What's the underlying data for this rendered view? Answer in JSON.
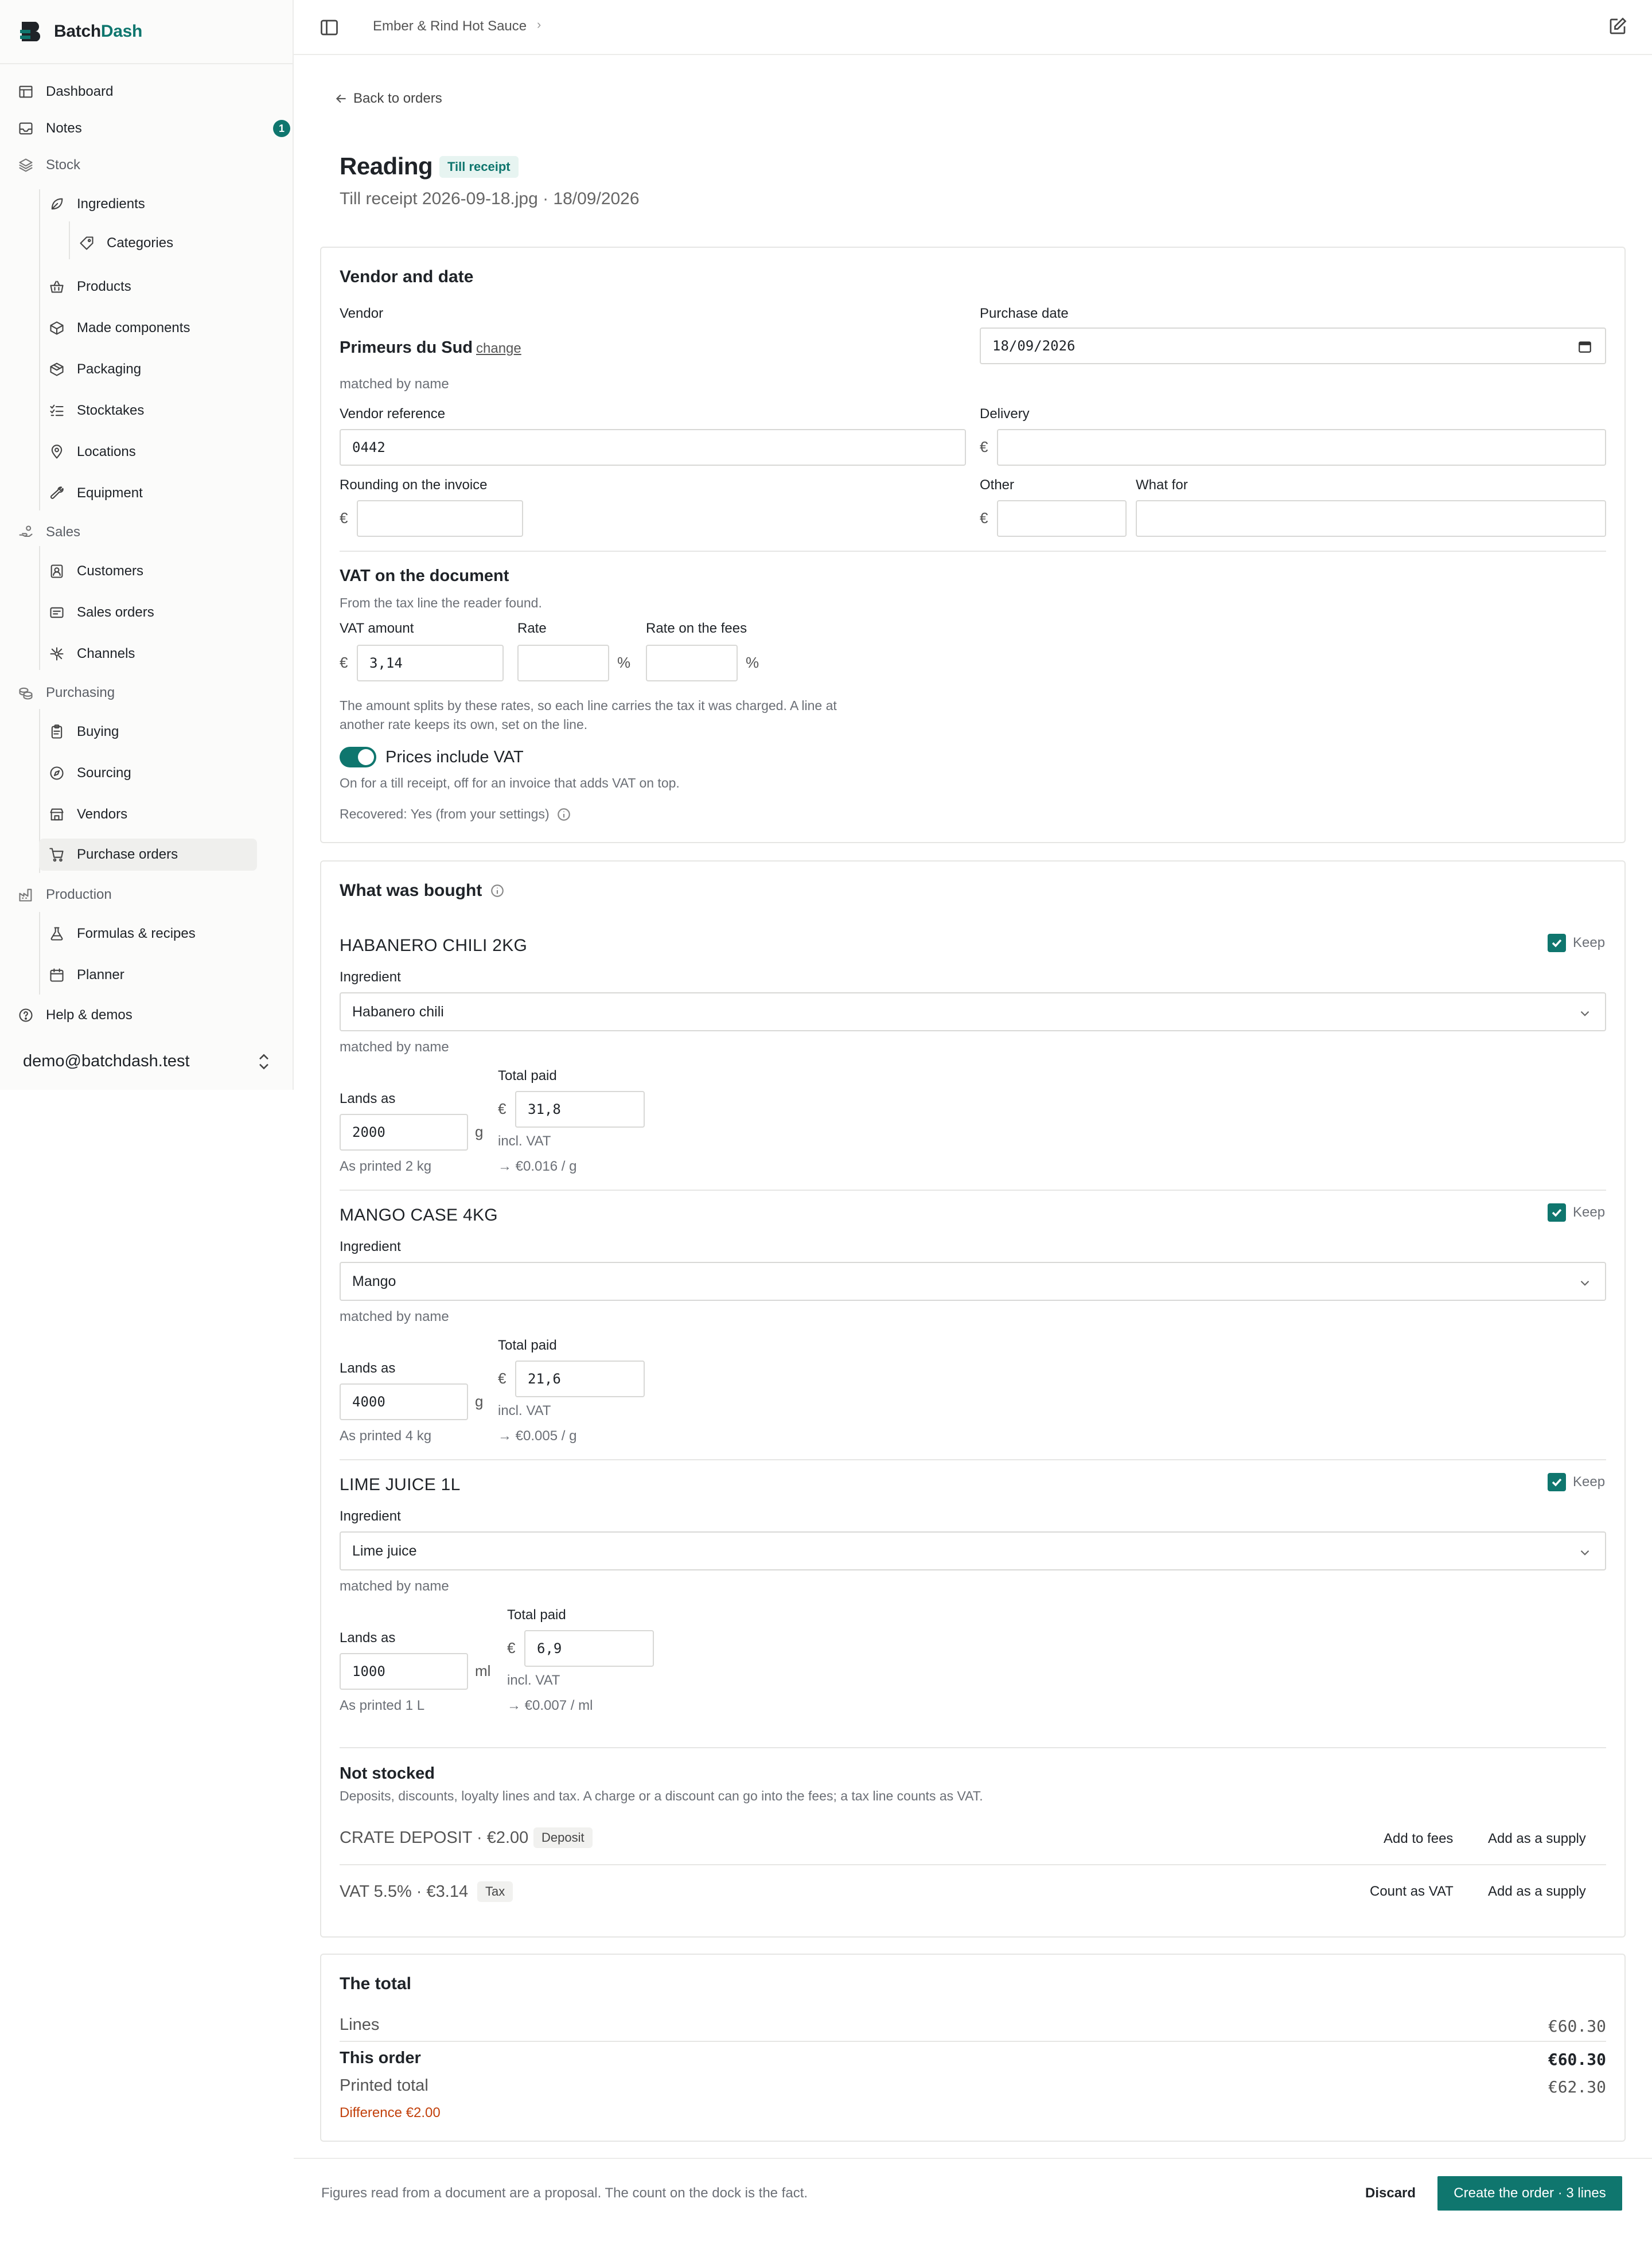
{
  "app": {
    "name_prefix": "Batch",
    "name_suffix": "Dash"
  },
  "colors": {
    "accent": "#0f766e",
    "warning": "#c2410c"
  },
  "sidebar": {
    "items": [
      {
        "label": "Dashboard",
        "icon": "table-icon"
      },
      {
        "label": "Notes",
        "icon": "inbox-icon",
        "badge": "1"
      },
      {
        "label": "Stock",
        "icon": "layers-icon"
      },
      {
        "label": "Ingredients",
        "icon": "leaf-icon"
      },
      {
        "label": "Categories",
        "icon": "tag-icon"
      },
      {
        "label": "Products",
        "icon": "basket-icon"
      },
      {
        "label": "Made components",
        "icon": "box-icon"
      },
      {
        "label": "Packaging",
        "icon": "package-icon"
      },
      {
        "label": "Stocktakes",
        "icon": "list-check-icon"
      },
      {
        "label": "Locations",
        "icon": "map-pin-icon"
      },
      {
        "label": "Equipment",
        "icon": "wrench-icon"
      },
      {
        "label": "Sales",
        "icon": "hand-coins-icon"
      },
      {
        "label": "Customers",
        "icon": "contact-icon"
      },
      {
        "label": "Sales orders",
        "icon": "receipt-icon"
      },
      {
        "label": "Channels",
        "icon": "network-icon"
      },
      {
        "label": "Purchasing",
        "icon": "coins-icon"
      },
      {
        "label": "Buying",
        "icon": "clipboard-icon"
      },
      {
        "label": "Sourcing",
        "icon": "compass-icon"
      },
      {
        "label": "Vendors",
        "icon": "store-icon"
      },
      {
        "label": "Purchase orders",
        "icon": "cart-icon"
      },
      {
        "label": "Production",
        "icon": "factory-icon"
      },
      {
        "label": "Formulas & recipes",
        "icon": "flask-icon"
      },
      {
        "label": "Planner",
        "icon": "calendar-icon"
      },
      {
        "label": "Help & demos",
        "icon": "help-icon"
      }
    ],
    "account": "demo@batchdash.test"
  },
  "header": {
    "breadcrumb": "Ember & Rind Hot Sauce"
  },
  "page": {
    "back_label": "Back to orders",
    "title": "Reading",
    "tag": "Till receipt",
    "subtitle": "Till receipt 2026-09-18.jpg · 18/09/2026"
  },
  "vendor_card": {
    "title": "Vendor and date",
    "vendor_label": "Vendor",
    "vendor_name": "Primeurs du Sud",
    "change_label": "change",
    "match_note": "matched by name",
    "purchase_date_label": "Purchase date",
    "purchase_date": "18/09/2026",
    "vendor_ref_label": "Vendor reference",
    "vendor_ref": "0442",
    "delivery_label": "Delivery",
    "delivery_value": "",
    "rounding_label": "Rounding on the invoice",
    "rounding_value": "",
    "other_label": "Other",
    "other_value": "",
    "what_for_label": "What for",
    "what_for_value": "",
    "currency": "€",
    "vat_title": "VAT on the document",
    "vat_source": "From the tax line the reader found.",
    "vat_amount_label": "VAT amount",
    "vat_amount": "3,14",
    "rate_label": "Rate",
    "rate_value": "",
    "fees_rate_label": "Rate on the fees",
    "fees_rate_value": "",
    "percent": "%",
    "vat_help_1": "The amount splits by these rates, so each line carries the tax it was charged. A line at",
    "vat_help_2": "another rate keeps its own, set on the line.",
    "prices_incl_label": "Prices include VAT",
    "prices_incl_on": true,
    "prices_incl_help": "On for a till receipt, off for an invoice that adds VAT on top.",
    "recovered": "Recovered: Yes (from your settings)"
  },
  "bought_card": {
    "title": "What was bought",
    "keep_label": "Keep",
    "ingredient_label": "Ingredient",
    "match_note": "matched by name",
    "lands_label": "Lands as",
    "total_label": "Total paid",
    "incl_vat": "incl. VAT",
    "lines": [
      {
        "name": "HABANERO CHILI 2KG",
        "ingredient": "Habanero chili",
        "lands": "2000",
        "unit": "g",
        "printed": "As printed 2 kg",
        "total": "31,8",
        "unit_cost": "→ €0.016 / g",
        "keep": true
      },
      {
        "name": "MANGO CASE 4KG",
        "ingredient": "Mango",
        "lands": "4000",
        "unit": "g",
        "printed": "As printed 4 kg",
        "total": "21,6",
        "unit_cost": "→ €0.005 / g",
        "keep": true
      },
      {
        "name": "LIME JUICE 1L",
        "ingredient": "Lime juice",
        "lands": "1000",
        "unit": "ml",
        "printed": "As printed 1 L",
        "total": "6,9",
        "unit_cost": "→ €0.007 / ml",
        "keep": true
      }
    ],
    "not_stocked_title": "Not stocked",
    "not_stocked_help": "Deposits, discounts, loyalty lines and tax. A charge or a discount can go into the fees; a tax line counts as VAT.",
    "extras": [
      {
        "label": "CRATE DEPOSIT · €2.00",
        "pill": "Deposit",
        "action1": "Add to fees",
        "action2": "Add as a supply"
      },
      {
        "label": "VAT 5.5% · €3.14",
        "pill": "Tax",
        "action1": "Count as VAT",
        "action2": "Add as a supply"
      }
    ]
  },
  "total_card": {
    "title": "The total",
    "lines_label": "Lines",
    "lines_value": "€60.30",
    "order_label": "This order",
    "order_value": "€60.30",
    "printed_label": "Printed total",
    "printed_value": "€62.30",
    "difference": "Difference €2.00"
  },
  "footer": {
    "note": "Figures read from a document are a proposal. The count on the dock is the fact.",
    "discard": "Discard",
    "create": "Create the order · 3 lines"
  }
}
